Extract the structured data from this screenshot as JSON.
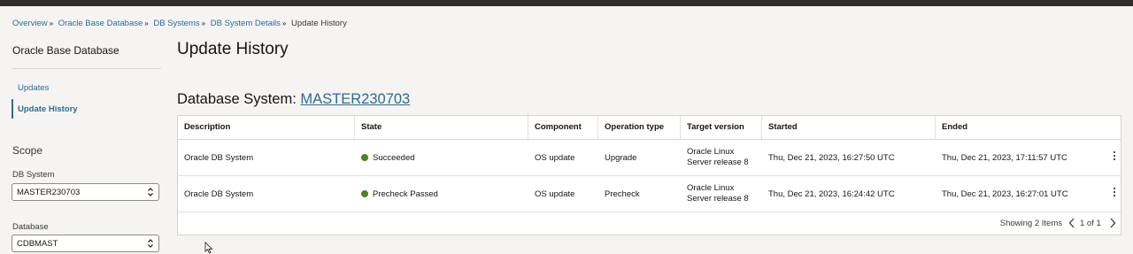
{
  "breadcrumb": {
    "items": [
      "Overview",
      "Oracle Base Database",
      "DB Systems",
      "DB System Details"
    ],
    "current": "Update History"
  },
  "sidebar": {
    "title": "Oracle Base Database",
    "links": [
      {
        "label": "Updates"
      },
      {
        "label": "Update History",
        "active": true
      }
    ]
  },
  "scope": {
    "title": "Scope",
    "db_system": {
      "label": "DB System",
      "value": "MASTER230703"
    },
    "database": {
      "label": "Database",
      "value": "CDBMAST"
    }
  },
  "main": {
    "title": "Update History",
    "section_prefix": "Database System: ",
    "section_link": "MASTER230703"
  },
  "table": {
    "columns": [
      "Description",
      "State",
      "Component",
      "Operation type",
      "Target version",
      "Started",
      "Ended"
    ],
    "rows": [
      {
        "description": "Oracle DB System",
        "state": "Succeeded",
        "component": "OS update",
        "operation": "Upgrade",
        "target_line1": "Oracle Linux",
        "target_line2": "Server release 8",
        "started": "Thu, Dec 21, 2023, 16:27:50 UTC",
        "ended": "Thu, Dec 21, 2023, 17:11:57 UTC"
      },
      {
        "description": "Oracle DB System",
        "state": "Precheck Passed",
        "component": "OS update",
        "operation": "Precheck",
        "target_line1": "Oracle Linux",
        "target_line2": "Server release 8",
        "started": "Thu, Dec 21, 2023, 16:24:42 UTC",
        "ended": "Thu, Dec 21, 2023, 16:27:01 UTC"
      }
    ],
    "footer": {
      "count": "Showing 2 Items",
      "page": "1 of 1"
    }
  },
  "colors": {
    "accent": "#2e6b8f",
    "success": "#508223",
    "topbar": "#312d2a"
  },
  "icons": [
    "chevron-updown-icon",
    "kebab-menu-icon",
    "chevron-left-icon",
    "chevron-right-icon",
    "mouse-cursor-icon"
  ]
}
